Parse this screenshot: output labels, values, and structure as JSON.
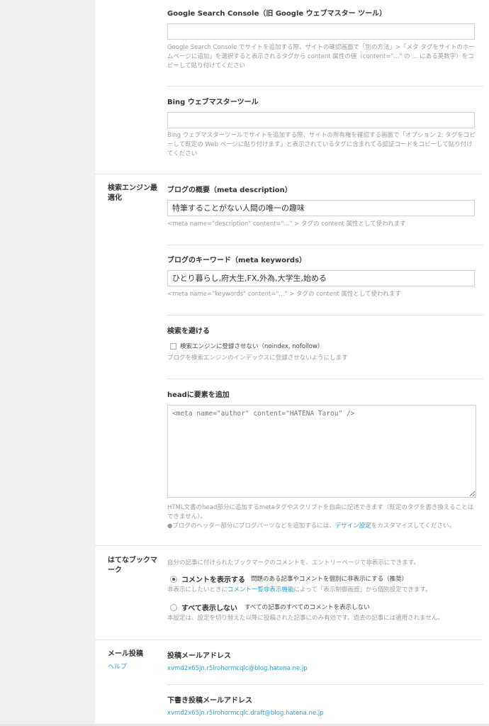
{
  "gsc": {
    "title": "Google Search Console（旧 Google ウェブマスター ツール）",
    "value": "",
    "help": "Google Search Console でサイトを追加する際、サイトの確認画面で「別の方法」>「メタ タグをサイトのホームページに追加」を選択すると表示されるタグから content 属性の値（content=\"...\" の ... にある英数字）をコピーして貼り付けてください"
  },
  "bing": {
    "title": "Bing ウェブマスターツール",
    "value": "",
    "help": "Bing ウェブマスターツールでサイトを追加する際、サイトの所有権を確認する画面で「オプション 2: タグをコピーして既定の Web ページに貼り付けます」と表示されているタグに含まれてる認証コードをコピーして貼り付けてください"
  },
  "seo": {
    "section_label": "検索エンジン最適化",
    "description": {
      "title": "ブログの概要（meta description）",
      "value": "特筆することがない人間の唯一の趣味",
      "help": "<meta name=\"description\" content=\"...\" > タグの content 属性として使われます"
    },
    "keywords": {
      "title": "ブログのキーワード（meta keywords）",
      "value": "ひとり暮らし,府大生,FX,外為,大学生,始める",
      "help": "<meta name=\"keywords\" content=\"...\" > タグの content 属性として使われます"
    },
    "avoid": {
      "title": "検索を避ける",
      "checkbox_label": "検索エンジンに登録させない（noindex, nofollow）",
      "checked": false,
      "help": "ブログを検索エンジンのインデックスに登録させないようにします"
    },
    "head": {
      "title": "headに要素を追加",
      "placeholder": "<meta name=\"author\" content=\"HATENA Tarou\" />",
      "help1": "HTML文書のhead部分に追加するmetaタグやスクリプトを自由に記述できます（既定のタグを書き換えることはできません）。",
      "help2_prefix": "●ブログのヘッダー部分にブログパーツなどを追加するには、",
      "help2_link": "デザイン設定",
      "help2_suffix": "をカスタマイズしてください。"
    }
  },
  "bookmark": {
    "section_label": "はてなブックマーク",
    "intro": "自分の記事に付けられたブックマークのコメントを、エントリーページで非表示にできます。",
    "option1_label": "コメントを表示する",
    "option1_desc": "問題のある記事やコメントを個別に非表示にする（推奨）",
    "option1_selected": true,
    "option1_note_prefix": "非表示にしたいときに",
    "option1_note_link": "コメント一覧非表示機能",
    "option1_note_suffix": "によって「表示制御画面」から個別設定できます。",
    "option2_label": "すべて表示しない",
    "option2_desc": "すべての記事のすべてのコメントを表示しない",
    "option2_selected": false,
    "note": "本設定は、設定を切り替えた以降に投稿された記事にのみ有効です。過去の記事には適用されません。"
  },
  "mail": {
    "section_label": "メール投稿",
    "help_link": "ヘルプ",
    "post_title": "投稿メールアドレス",
    "post_address": "xvmd2x65jn.r5lrohormcqlc@blog.hatena.ne.jp",
    "draft_title": "下書き投稿メールアドレス",
    "draft_address": "xvmd2x65jn.r5lrohormcqlc.draft@blog.hatena.ne.jp"
  },
  "colors": {
    "link": "#2a9fd8",
    "help_text": "#9a9a9a",
    "border": "#cfcfcf"
  }
}
